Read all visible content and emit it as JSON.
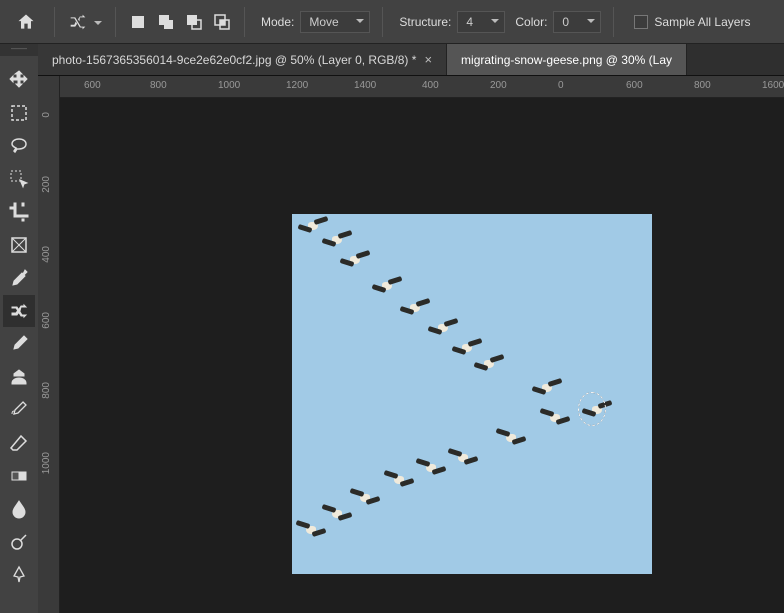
{
  "optbar": {
    "mode_label": "Mode:",
    "mode_value": "Move",
    "structure_label": "Structure:",
    "structure_value": "4",
    "color_label": "Color:",
    "color_value": "0",
    "sample_label": "Sample All Layers"
  },
  "tabs": [
    {
      "label": "photo-1567365356014-9ce2e62e0cf2.jpg @ 50% (Layer 0, RGB/8) *",
      "active": false,
      "closeable": true
    },
    {
      "label": "migrating-snow-geese.png @ 30% (Lay",
      "active": true,
      "closeable": false
    }
  ],
  "hruler": [
    "600",
    "800",
    "1000",
    "1200",
    "1400",
    "400",
    "200",
    "0",
    "1600"
  ],
  "vruler": [
    "800",
    "0",
    "200",
    "400",
    "600",
    "1000"
  ],
  "tools": [
    "move-tool",
    "marquee-tool",
    "lasso-tool",
    "quick-select-tool",
    "crop-tool",
    "frame-tool",
    "eyedropper-tool",
    "content-aware-move-tool",
    "brush-tool",
    "clone-stamp-tool",
    "history-brush-tool",
    "eraser-tool",
    "gradient-tool",
    "blur-tool",
    "dodge-tool",
    "pen-tool"
  ],
  "active_tool": "content-aware-move-tool",
  "sidecap": "——"
}
